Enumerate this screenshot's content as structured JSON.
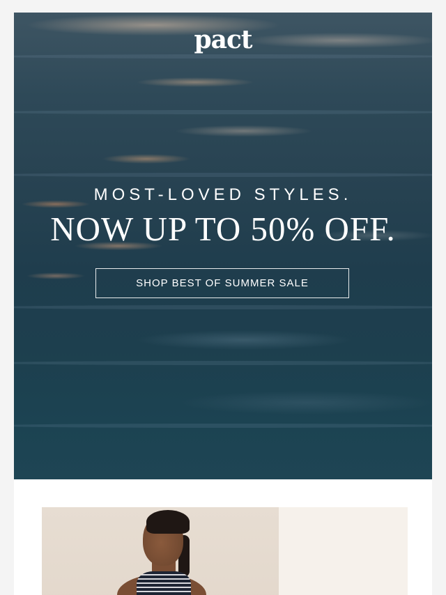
{
  "brand": {
    "logo_text": "pact"
  },
  "hero": {
    "eyebrow": "MOST-LOVED STYLES.",
    "headline": "NOW UP TO 50% OFF.",
    "cta_label": "SHOP BEST OF SUMMER SALE"
  },
  "colors": {
    "page_background": "#f4f4f4",
    "hero_water": "#1f3d4d",
    "text_on_hero": "#ffffff",
    "product_background": "#e5dacf",
    "tank_top": "#1d2433"
  },
  "product": {
    "image_subject": "model-in-striped-tank-top"
  }
}
